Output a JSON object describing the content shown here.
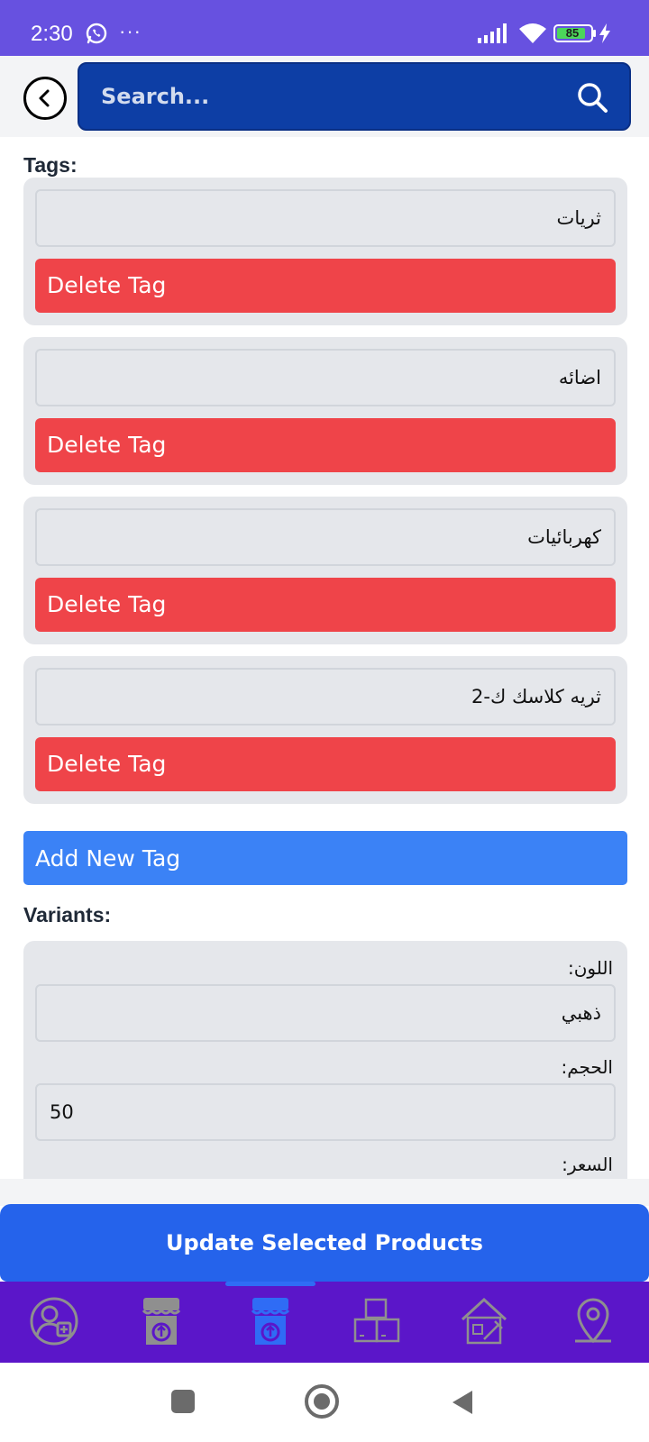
{
  "status_bar": {
    "time": "2:30",
    "more_dots": "···",
    "battery_level": "85"
  },
  "header": {
    "search_placeholder": "Search..."
  },
  "tags": {
    "label": "Tags:",
    "items": [
      {
        "value": "ثريات",
        "delete_label": "Delete Tag"
      },
      {
        "value": "اضائه",
        "delete_label": "Delete Tag"
      },
      {
        "value": "كهربائيات",
        "delete_label": "Delete Tag"
      },
      {
        "value": "ثريه كلاسك ك-2",
        "delete_label": "Delete Tag"
      }
    ],
    "add_label": "Add New Tag"
  },
  "variants": {
    "label": "Variants:",
    "fields": [
      {
        "label": "اللون:",
        "value": "ذهبي"
      },
      {
        "label": "الحجم:",
        "value": "50"
      },
      {
        "label": "السعر:",
        "value": ""
      }
    ]
  },
  "update_button": "Update Selected Products",
  "bottom_nav": {
    "items": [
      {
        "icon": "add-user-icon",
        "active": false
      },
      {
        "icon": "store-upload-icon",
        "active": false
      },
      {
        "icon": "store-upload-icon",
        "active": true
      },
      {
        "icon": "boxes-icon",
        "active": false
      },
      {
        "icon": "house-tools-icon",
        "active": false
      },
      {
        "icon": "location-pin-icon",
        "active": false
      }
    ]
  },
  "colors": {
    "status_bar": "#6751e0",
    "search_bg": "#0d3ea5",
    "delete": "#ef4449",
    "add": "#3b82f6",
    "update": "#2563eb",
    "nav_bg": "#5b16c9",
    "nav_active": "#2f6cf5"
  }
}
